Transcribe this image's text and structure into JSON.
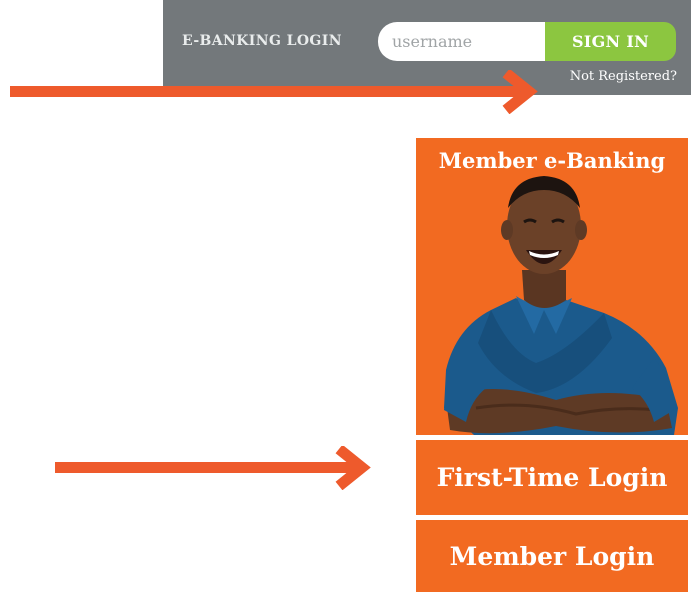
{
  "login_bar": {
    "title": "E-BANKING LOGIN",
    "username_placeholder": "username",
    "username_value": "",
    "signin_label": "SIGN IN",
    "register_link": "Not Registered?"
  },
  "member_panel": {
    "title": "Member e-Banking",
    "first_time_label": "First-Time Login",
    "member_login_label": "Member Login"
  },
  "colors": {
    "bar_gray": "#73787b",
    "signin_green": "#8cc640",
    "brand_orange": "#f26a21",
    "arrow_orange": "#ee5a2c"
  },
  "icons": {
    "arrow_top": "arrow-right-icon",
    "arrow_middle": "arrow-right-icon"
  }
}
